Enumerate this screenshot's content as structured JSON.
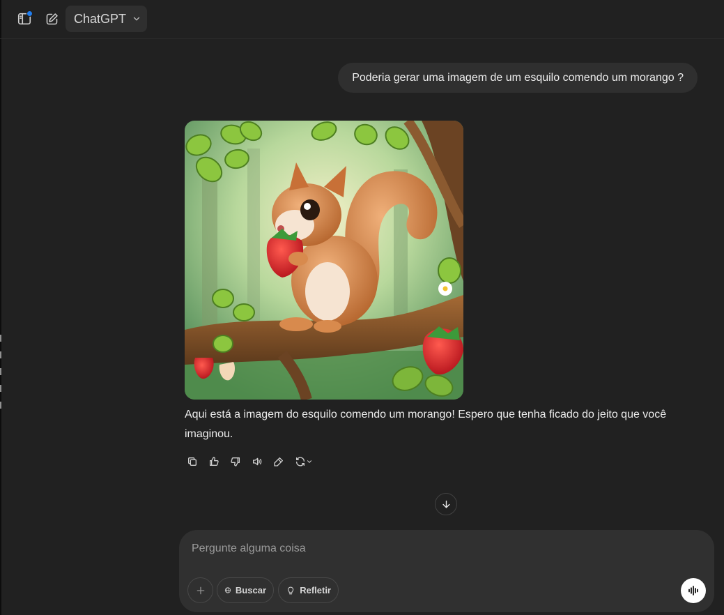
{
  "header": {
    "model_name": "ChatGPT",
    "icons": [
      "sidebar-toggle-icon",
      "new-chat-icon",
      "chevron-down-icon"
    ]
  },
  "conversation": {
    "user_message": "Poderia gerar uma imagem de um esquilo comendo um morango ?",
    "assistant_message": "Aqui está a imagem do esquilo comendo um morango! Espero que tenha ficado do jeito que você imaginou.",
    "message_actions": [
      "copy-icon",
      "thumbs-up-icon",
      "thumbs-down-icon",
      "read-aloud-icon",
      "edit-icon",
      "regenerate-icon"
    ]
  },
  "composer": {
    "placeholder": "Pergunte alguma coisa",
    "search_label": "Buscar",
    "reason_label": "Refletir"
  },
  "colors": {
    "background": "#212121",
    "bubble": "#2f2f2f",
    "composer": "#303030",
    "accent_dot": "#1f7df0"
  }
}
